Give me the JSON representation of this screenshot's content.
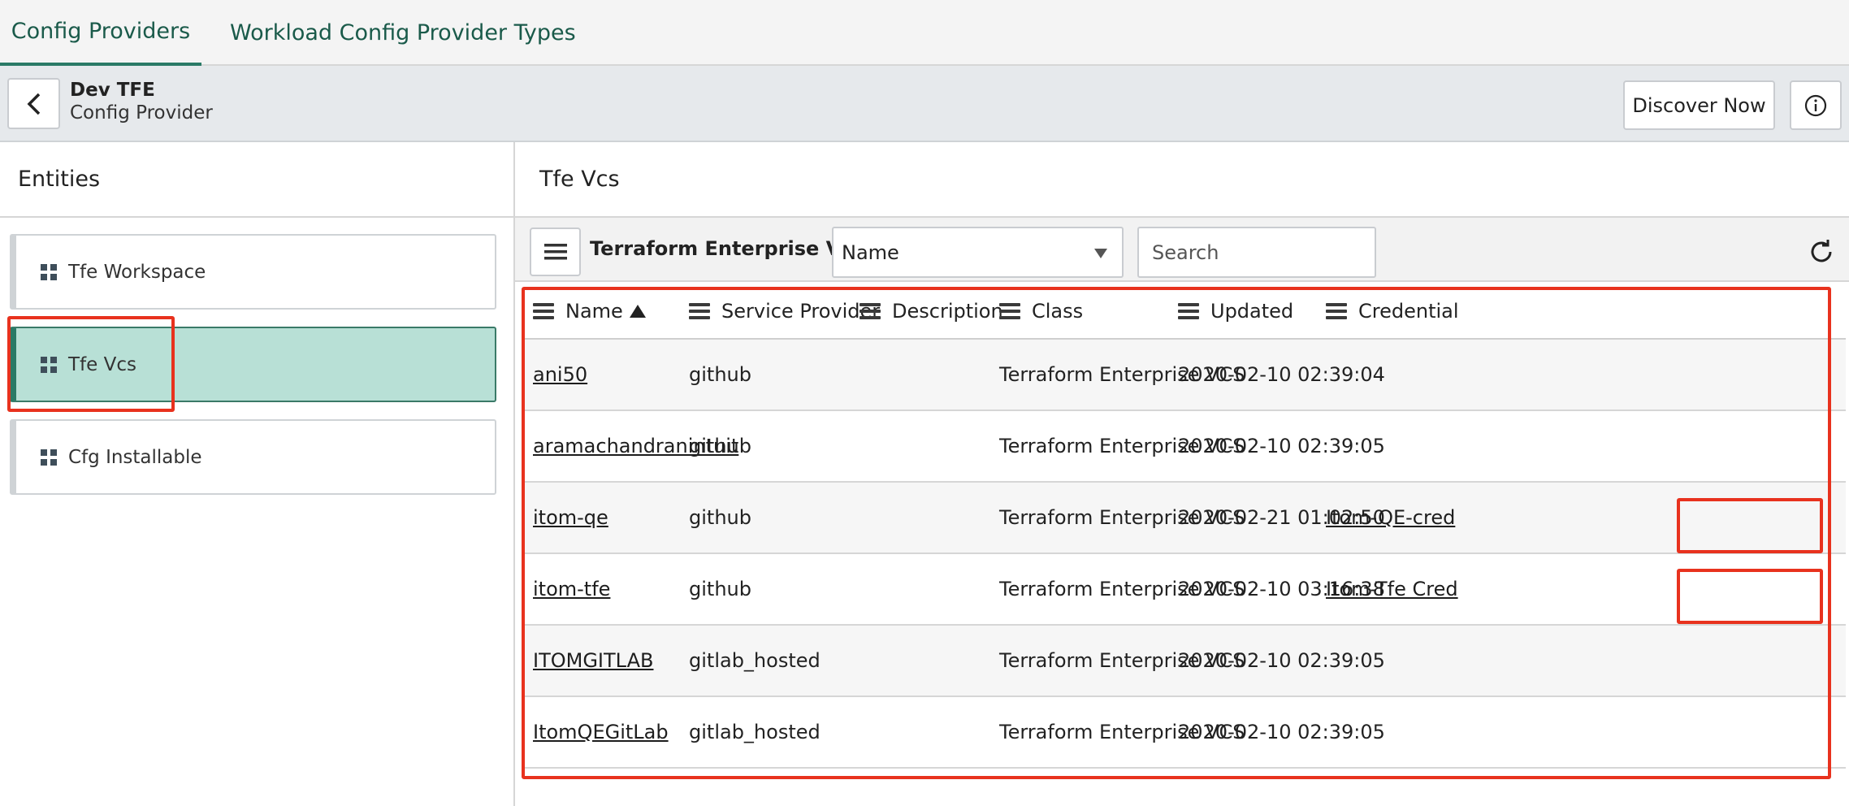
{
  "tabs": [
    {
      "label": "Config Providers"
    },
    {
      "label": "Workload Config Provider Types"
    }
  ],
  "record": {
    "title": "Dev TFE",
    "subtitle": "Config Provider",
    "discover_label": "Discover Now"
  },
  "entities": {
    "title": "Entities",
    "items": [
      {
        "label": "Tfe Workspace"
      },
      {
        "label": "Tfe Vcs"
      },
      {
        "label": "Cfg Installable"
      }
    ],
    "selected": "Tfe Vcs"
  },
  "list": {
    "panel_title": "Tfe Vcs",
    "title": "Terraform Enterprise VCSs",
    "filter_field": "Name",
    "search_placeholder": "Search",
    "columns": [
      "Name",
      "Service Provider",
      "Description",
      "Class",
      "Updated",
      "Credential"
    ],
    "sort_column": "Name",
    "sort_direction": "ascending",
    "rows": [
      {
        "name": "ani50",
        "service_provider": "github",
        "description": "",
        "class": "Terraform Enterprise VCS",
        "updated": "2020-02-10 02:39:04",
        "credential": ""
      },
      {
        "name": "aramachandranintuit",
        "service_provider": "github",
        "description": "",
        "class": "Terraform Enterprise VCS",
        "updated": "2020-02-10 02:39:05",
        "credential": ""
      },
      {
        "name": "itom-qe",
        "service_provider": "github",
        "description": "",
        "class": "Terraform Enterprise VCS",
        "updated": "2020-02-21 01:02:50",
        "credential": "Itom-QE-cred"
      },
      {
        "name": "itom-tfe",
        "service_provider": "github",
        "description": "",
        "class": "Terraform Enterprise VCS",
        "updated": "2020-02-10 03:16:38",
        "credential": "Itom-Tfe Cred"
      },
      {
        "name": "ITOMGITLAB",
        "service_provider": "gitlab_hosted",
        "description": "",
        "class": "Terraform Enterprise VCS",
        "updated": "2020-02-10 02:39:05",
        "credential": ""
      },
      {
        "name": "ItomQEGitLab",
        "service_provider": "gitlab_hosted",
        "description": "",
        "class": "Terraform Enterprise VCS",
        "updated": "2020-02-10 02:39:05",
        "credential": ""
      }
    ]
  },
  "icons": {
    "back": "chevron-left-icon",
    "info": "info-icon",
    "menu": "hamburger-icon",
    "refresh": "refresh-icon",
    "entity": "grid-icon"
  },
  "colors": {
    "accent": "#2a7a66",
    "selected_bg": "#b8e0d6",
    "annotation": "#e8321e"
  }
}
